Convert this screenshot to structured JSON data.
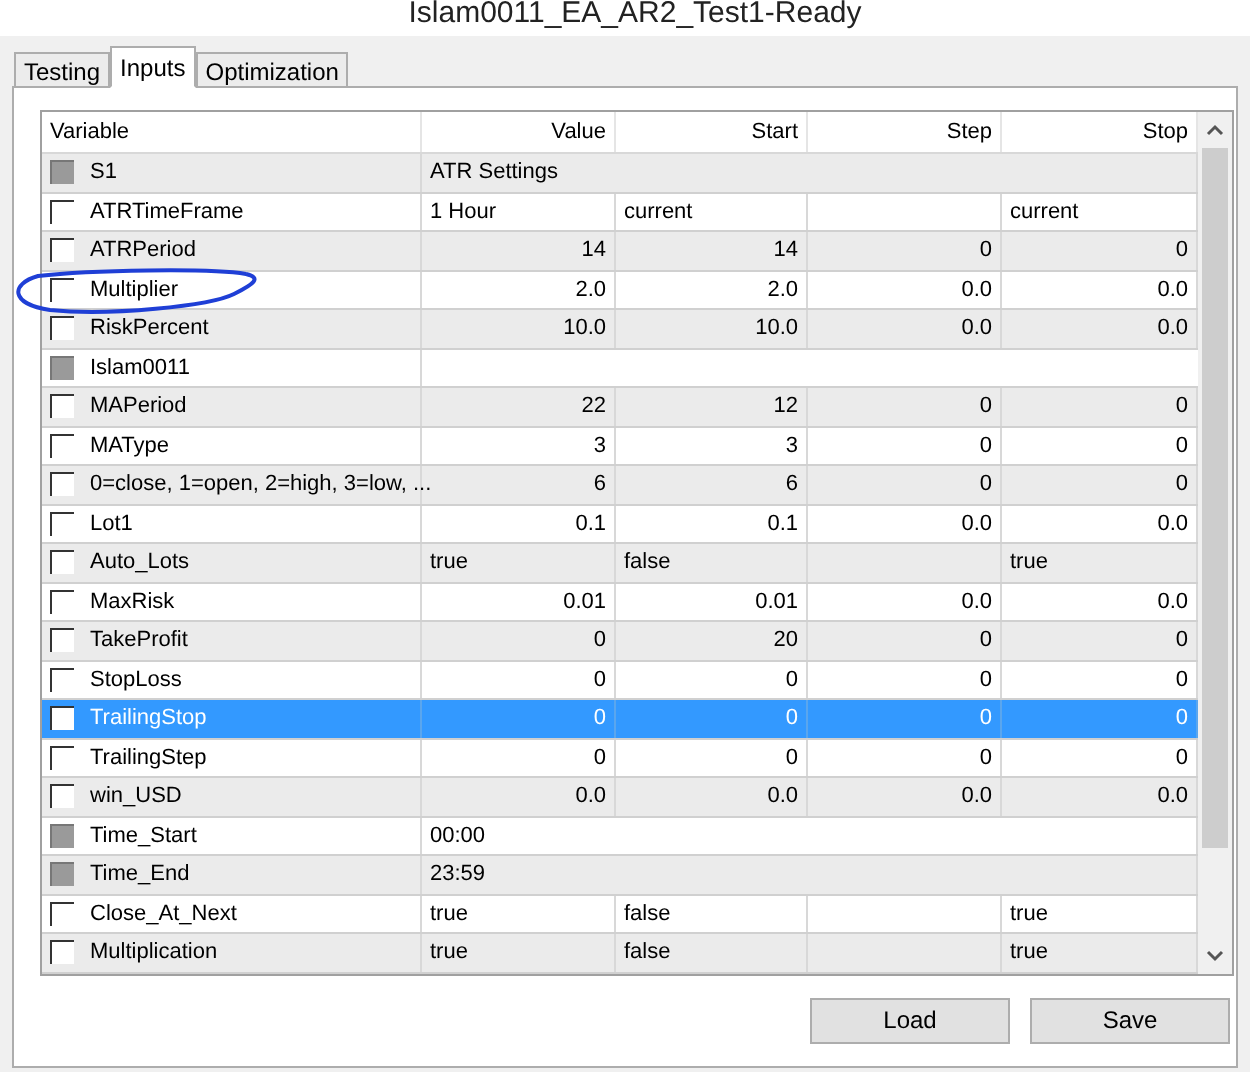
{
  "window": {
    "title": "Islam0011_EA_AR2_Test1-Ready"
  },
  "tabs": [
    {
      "label": "Testing",
      "selected": false
    },
    {
      "label": "Inputs",
      "selected": true
    },
    {
      "label": "Optimization",
      "selected": false
    }
  ],
  "table": {
    "columns": [
      "Variable",
      "Value",
      "Start",
      "Step",
      "Stop"
    ],
    "rows": [
      {
        "kind": "section",
        "name": "S1",
        "checked": false,
        "disabled": true,
        "selected": false,
        "value": "ATR Settings"
      },
      {
        "kind": "text",
        "name": "ATRTimeFrame",
        "checked": false,
        "disabled": false,
        "selected": false,
        "value": "1 Hour",
        "start": "current",
        "stop": "current"
      },
      {
        "kind": "number",
        "name": "ATRPeriod",
        "checked": false,
        "disabled": false,
        "selected": false,
        "value": "14",
        "start": "14",
        "step": "0",
        "stop": "0"
      },
      {
        "kind": "number",
        "name": "Multiplier",
        "checked": false,
        "disabled": false,
        "selected": false,
        "value": "2.0",
        "start": "2.0",
        "step": "0.0",
        "stop": "0.0"
      },
      {
        "kind": "number",
        "name": "RiskPercent",
        "checked": false,
        "disabled": false,
        "selected": false,
        "value": "10.0",
        "start": "10.0",
        "step": "0.0",
        "stop": "0.0"
      },
      {
        "kind": "section",
        "name": "Islam0011",
        "checked": false,
        "disabled": true,
        "selected": false
      },
      {
        "kind": "number",
        "name": "MAPeriod",
        "checked": false,
        "disabled": false,
        "selected": false,
        "value": "22",
        "start": "12",
        "step": "0",
        "stop": "0"
      },
      {
        "kind": "number",
        "name": "MAType",
        "checked": false,
        "disabled": false,
        "selected": false,
        "value": "3",
        "start": "3",
        "step": "0",
        "stop": "0"
      },
      {
        "kind": "number",
        "name": "0=close, 1=open, 2=high, 3=low, ...",
        "checked": false,
        "disabled": false,
        "selected": false,
        "value": "6",
        "start": "6",
        "step": "0",
        "stop": "0"
      },
      {
        "kind": "number",
        "name": "Lot1",
        "checked": false,
        "disabled": false,
        "selected": false,
        "value": "0.1",
        "start": "0.1",
        "step": "0.0",
        "stop": "0.0"
      },
      {
        "kind": "text",
        "name": "Auto_Lots",
        "checked": false,
        "disabled": false,
        "selected": false,
        "value": "true",
        "start": "false",
        "stop": "true"
      },
      {
        "kind": "number",
        "name": "MaxRisk",
        "checked": false,
        "disabled": false,
        "selected": false,
        "value": "0.01",
        "start": "0.01",
        "step": "0.0",
        "stop": "0.0"
      },
      {
        "kind": "number",
        "name": "TakeProfit",
        "checked": false,
        "disabled": false,
        "selected": false,
        "value": "0",
        "start": "20",
        "step": "0",
        "stop": "0"
      },
      {
        "kind": "number",
        "name": "StopLoss",
        "checked": false,
        "disabled": false,
        "selected": false,
        "value": "0",
        "start": "0",
        "step": "0",
        "stop": "0"
      },
      {
        "kind": "number",
        "name": "TrailingStop",
        "checked": false,
        "disabled": false,
        "selected": true,
        "value": "0",
        "start": "0",
        "step": "0",
        "stop": "0"
      },
      {
        "kind": "number",
        "name": "TrailingStep",
        "checked": false,
        "disabled": false,
        "selected": false,
        "value": "0",
        "start": "0",
        "step": "0",
        "stop": "0"
      },
      {
        "kind": "number",
        "name": "win_USD",
        "checked": false,
        "disabled": false,
        "selected": false,
        "value": "0.0",
        "start": "0.0",
        "step": "0.0",
        "stop": "0.0"
      },
      {
        "kind": "section",
        "name": "Time_Start",
        "checked": false,
        "disabled": true,
        "selected": false,
        "value": "00:00"
      },
      {
        "kind": "section",
        "name": "Time_End",
        "checked": false,
        "disabled": true,
        "selected": false,
        "value": "23:59"
      },
      {
        "kind": "text",
        "name": "Close_At_Next",
        "checked": false,
        "disabled": false,
        "selected": false,
        "value": "true",
        "start": "false",
        "stop": "true"
      },
      {
        "kind": "text",
        "name": "Multiplication",
        "checked": false,
        "disabled": false,
        "selected": false,
        "value": "true",
        "start": "false",
        "stop": "true"
      }
    ]
  },
  "buttons": [
    "Load",
    "Save"
  ]
}
